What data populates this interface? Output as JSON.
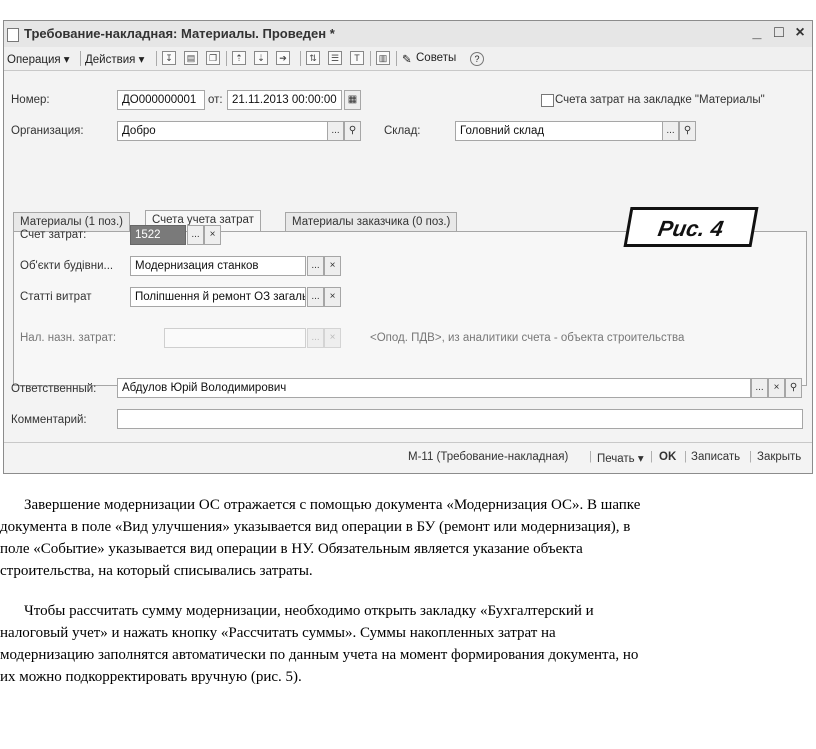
{
  "window": {
    "title": "Требование-накладная: Материалы. Проведен *",
    "controls": {
      "minimize": "_",
      "maximize": "□",
      "close": "×"
    }
  },
  "toolbar": {
    "operation": "Операция ▾",
    "actions": "Действия ▾",
    "tips": "Советы",
    "help": "?"
  },
  "header": {
    "number_label": "Номер:",
    "number_value": "ДО000000001",
    "date_label": "от:",
    "date_value": "21.11.2013 00:00:00",
    "org_label": "Организация:",
    "org_value": "Добро",
    "warehouse_label": "Склад:",
    "warehouse_value": "Головний склад",
    "checkbox_label": "Счета затрат на закладке \"Материалы\""
  },
  "tabs": [
    {
      "label": "Материалы (1 поз.)"
    },
    {
      "label": "Счета учета затрат"
    },
    {
      "label": "Материалы заказчика (0 поз.)"
    }
  ],
  "figure_label": "Рис. 4",
  "cost_panel": {
    "account_label": "Счет затрат:",
    "account_value": "1522",
    "object_label": "Об'єкти будівни...",
    "object_value": "Модернизация станков",
    "articles_label": "Статті витрат",
    "articles_value": "Поліпшення й ремонт ОЗ загаль",
    "tax_label": "Нал. назн. затрат:",
    "tax_value": "",
    "tax_hint": "<Опод. ПДВ>, из аналитики счета - объекта строительства"
  },
  "footer": {
    "responsible_label": "Ответственный:",
    "responsible_value": "Абдулов Юрій Володимирович",
    "comment_label": "Комментарий:",
    "comment_value": ""
  },
  "statusbar": {
    "form": "М-11 (Требование-накладная)",
    "print": "Печать ▾",
    "ok": "OK",
    "save": "Записать",
    "close": "Закрыть"
  },
  "glyphs": {
    "ellipsis": "...",
    "clear": "×",
    "search": "🔍"
  },
  "body_text": {
    "p1": [
      "Завершение модернизации ОС отражается с помощью документа «Модернизация ОС». В шапке",
      "документа в поле «Вид улучшения» указывается вид операции в БУ (ремонт или модернизация), в",
      "поле «Событие» указывается вид операции в НУ. Обязательным является указание объекта",
      "строительства, на который списывались затраты."
    ],
    "p2": [
      "Чтобы рассчитать сумму модернизации, необходимо открыть закладку «Бухгалтерский и",
      "налоговый учет» и нажать кнопку «Рассчитать суммы». Суммы накопленных затрат на",
      "модернизацию заполнятся автоматически по данным учета на момент формирования документа, но",
      "их можно подкорректировать вручную (рис. 5)."
    ]
  }
}
